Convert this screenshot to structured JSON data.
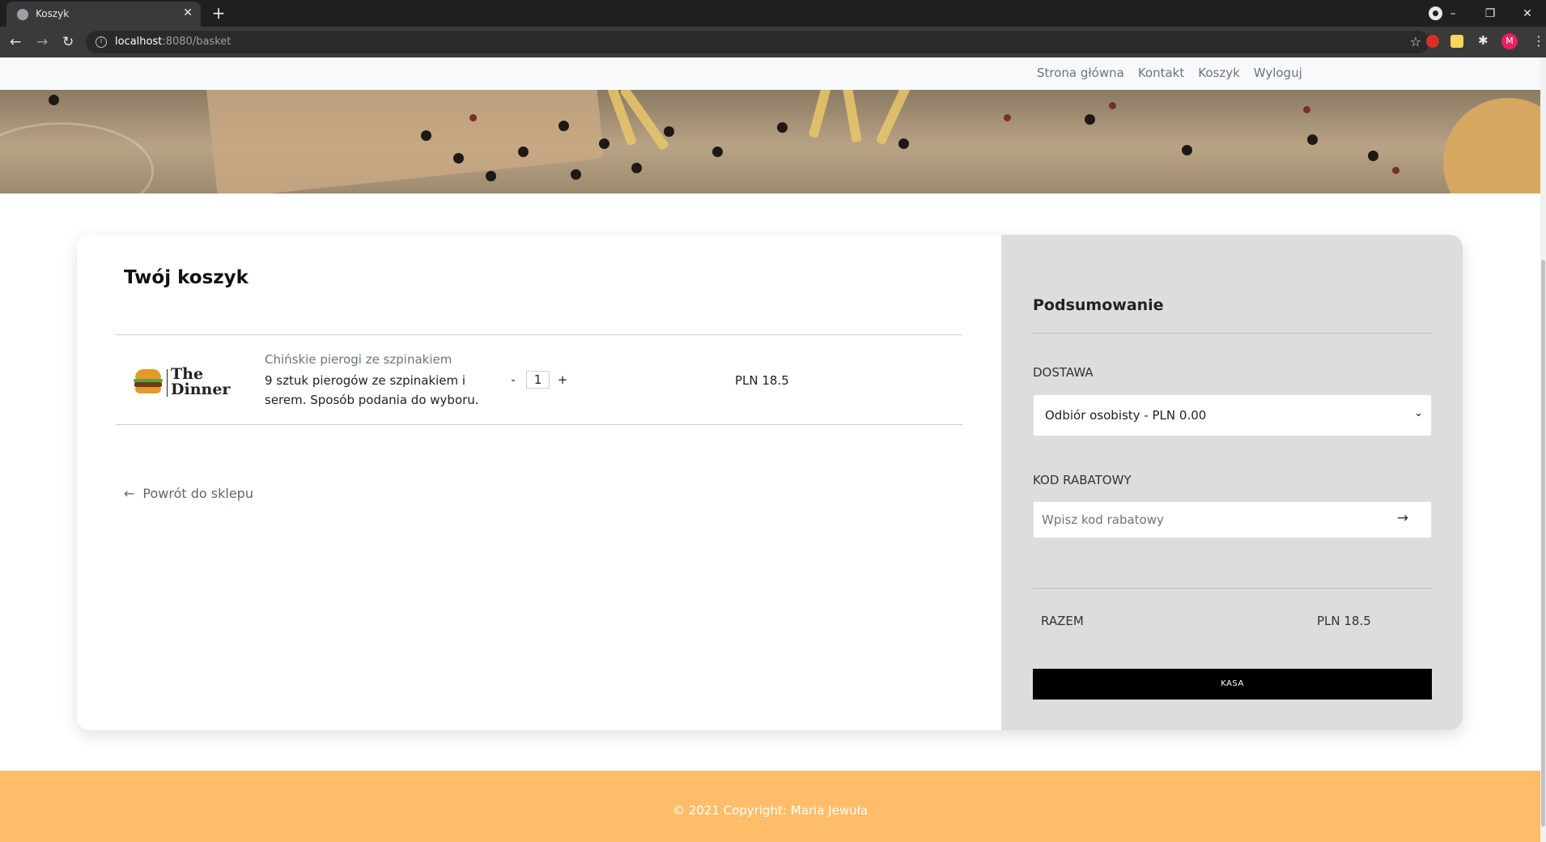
{
  "browser": {
    "tab_title": "Koszyk",
    "tab_close": "✕",
    "new_tab": "+",
    "url_host": "localhost",
    "url_path": ":8080/basket",
    "avatar_letter": "M",
    "window_controls": [
      "–",
      "❐",
      "✕"
    ]
  },
  "nav": {
    "links": [
      "Strona główna",
      "Kontakt",
      "Koszyk",
      "Wyloguj"
    ]
  },
  "basket": {
    "title": "Twój koszyk",
    "items": [
      {
        "name": "Chińskie pierogi ze szpinakiem",
        "description": "9 sztuk pierogów ze szpinakiem i serem. Sposób podania do wyboru.",
        "quantity": "1",
        "minus": "-",
        "plus": "+",
        "price": "PLN 18.5",
        "logo_text": "The Dinner"
      }
    ],
    "back_arrow": "←",
    "back_label": "Powrót do sklepu"
  },
  "summary": {
    "title": "Podsumowanie",
    "delivery_label": "DOSTAWA",
    "delivery_selected": "Odbiór osobisty - PLN 0.00",
    "promo_label": "KOD RABATOWY",
    "promo_placeholder": "Wpisz kod rabatowy",
    "promo_arrow": "→",
    "total_label": "RAZEM",
    "total_value": "PLN 18.5",
    "checkout_label": "KASA"
  },
  "footer": {
    "copyright": "© 2021 Copyright: Maria Jewuła"
  },
  "colors": {
    "footer_bg": "#ffbd69",
    "summary_bg": "#dddddd",
    "checkout_bg": "#000000"
  }
}
